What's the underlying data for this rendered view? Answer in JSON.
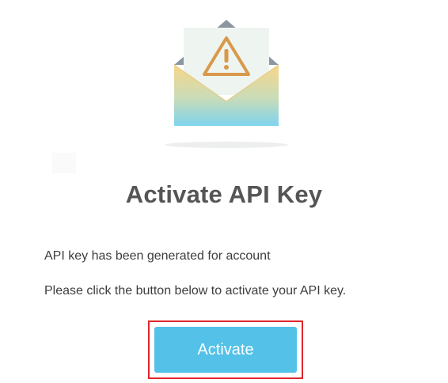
{
  "illustration": {
    "icon": "envelope-warning-icon",
    "colors": {
      "envelope_top": "#f5d58c",
      "envelope_bottom": "#7fd3ee",
      "letter": "#eef4f0",
      "warning": "#d9994a",
      "flap": "#8c96a0"
    }
  },
  "title": "Activate API Key",
  "message": {
    "line1": "API key has been generated for account",
    "line2": "Please click the button below to activate your API key."
  },
  "button": {
    "label": "Activate",
    "color": "#53c1e8"
  },
  "highlight_color": "#e0262d"
}
